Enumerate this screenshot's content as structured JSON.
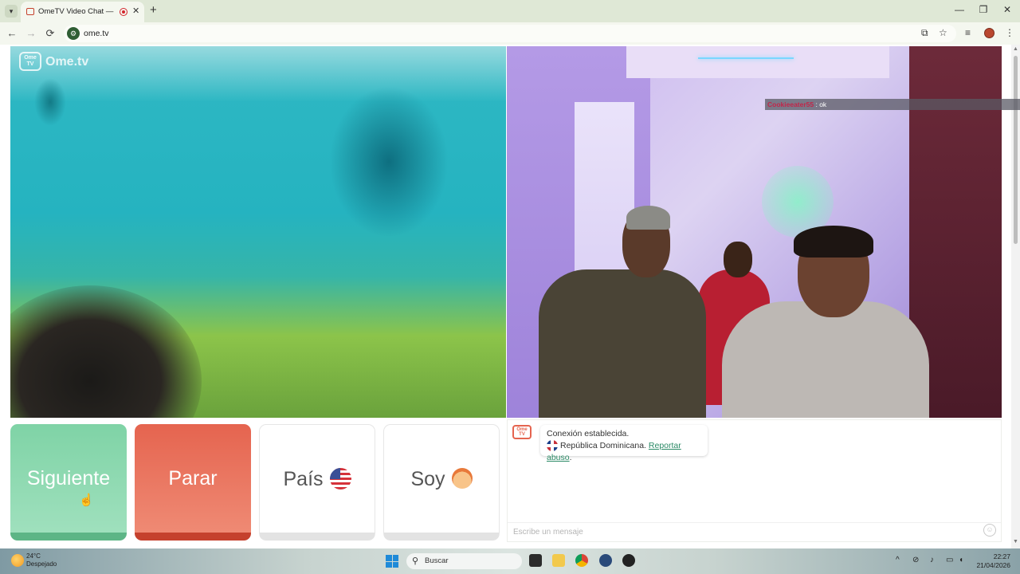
{
  "browser": {
    "tab_title": "OmeTV Video Chat — Omegle",
    "url": "ome.tv",
    "new_tab": "+",
    "tab_close": "✕"
  },
  "window_controls": {
    "minimize": "—",
    "restore": "❐",
    "close": "✕"
  },
  "nav": {
    "back": "←",
    "forward": "→",
    "reload": "⟳"
  },
  "logo": {
    "badge": "Ome TV",
    "text": "Ome.tv"
  },
  "remote_overlay": {
    "username": "Cookieeater55",
    "message": " : ok"
  },
  "buttons": {
    "next": "Siguiente",
    "stop": "Parar",
    "country": "País",
    "gender": "Soy"
  },
  "chat": {
    "logo_badge": "Ome TV",
    "status": "Conexión establecida.",
    "country": "República Dominicana.",
    "report_link": "Reportar abuso",
    "report_suffix": ".",
    "input_placeholder": "Escribe un mensaje",
    "emoji": "☺"
  },
  "taskbar": {
    "weather_temp": "24°C",
    "weather_desc": "Despejado",
    "search_label": "Buscar",
    "time": "22:27",
    "date": "21/04/2026"
  },
  "colors": {
    "next_green": "#7fd3a6",
    "stop_red": "#e5644f",
    "report_link": "#2b8a66"
  },
  "icons": [
    "dropdown-icon",
    "favicon-icon",
    "record-icon",
    "install-icon",
    "star-icon",
    "media-icon",
    "profile-icon",
    "menu-icon",
    "flag-us-icon",
    "face-icon",
    "flag-do-icon",
    "emoji-icon",
    "cursor-icon",
    "weather-icon",
    "windows-start-icon",
    "search-icon",
    "wifi-icon",
    "mic-icon",
    "volume-icon"
  ]
}
